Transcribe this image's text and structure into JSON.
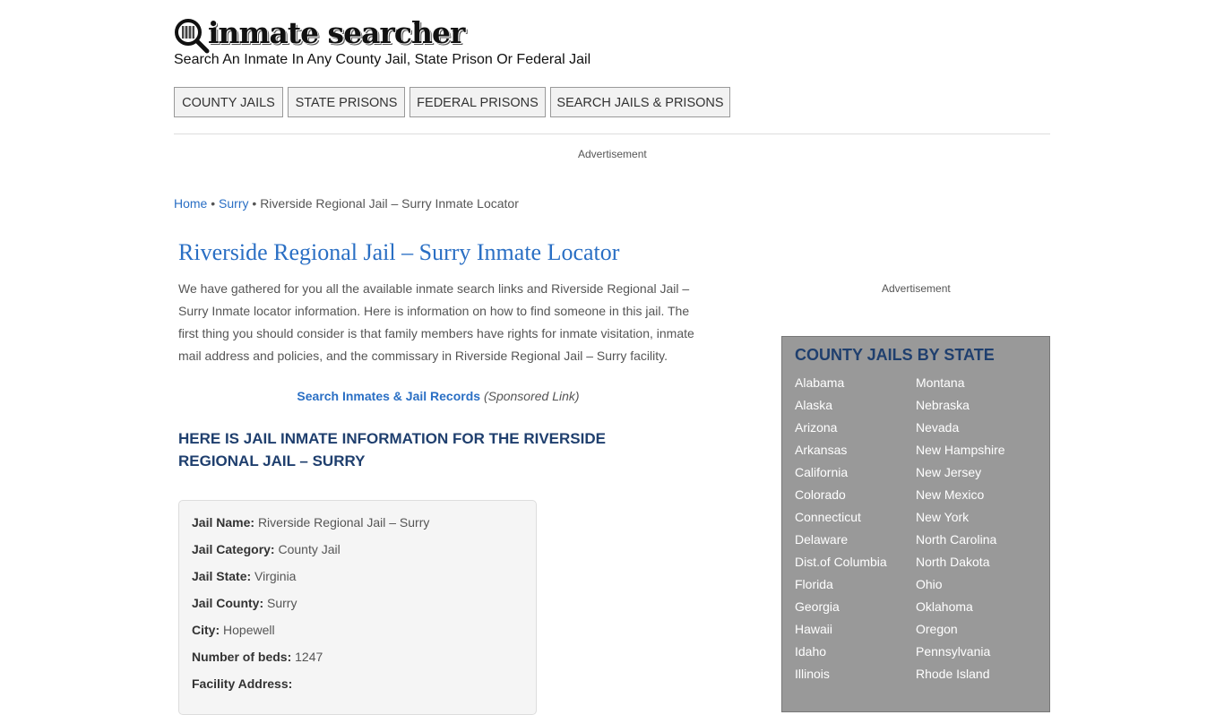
{
  "header": {
    "logo_text": "inmate searcher",
    "tagline": "Search An Inmate In Any County Jail, State Prison Or Federal Jail"
  },
  "nav": {
    "county": "COUNTY JAILS",
    "state": "STATE PRISONS",
    "federal": "FEDERAL PRISONS",
    "search": "SEARCH JAILS & PRISONS"
  },
  "ads": {
    "top": "Advertisement",
    "side": "Advertisement"
  },
  "breadcrumb": {
    "home": "Home",
    "sep": "•",
    "county": "Surry",
    "current": "Riverside Regional Jail – Surry Inmate Locator"
  },
  "main": {
    "title": "Riverside Regional Jail – Surry Inmate Locator",
    "intro": "We have gathered for you all the available inmate search links and Riverside Regional Jail – Surry Inmate locator information. Here is information on how to find someone in this jail. The first thing you should consider is that family members have rights for inmate visitation, inmate mail address and policies, and the commissary in Riverside Regional Jail – Surry facility.",
    "sponsored_link": "Search Inmates & Jail Records",
    "sponsored_note": "(Sponsored Link)",
    "info_heading": "Here is Jail Inmate Information for the Riverside Regional Jail – Surry"
  },
  "info": {
    "name_label": "Jail Name:",
    "name": "Riverside Regional Jail – Surry",
    "category_label": "Jail Category:",
    "category": "County Jail",
    "state_label": "Jail State:",
    "state": "Virginia",
    "county_label": "Jail County:",
    "county": "Surry",
    "city_label": "City:",
    "city": "Hopewell",
    "beds_label": "Number of beds:",
    "beds": "1247",
    "address_label": "Facility Address:"
  },
  "sidebar": {
    "title": "County Jails By State",
    "col1": [
      "Alabama",
      "Alaska",
      "Arizona",
      "Arkansas",
      "California",
      "Colorado",
      "Connecticut",
      "Delaware",
      "Dist.of Columbia",
      "Florida",
      "Georgia",
      "Hawaii",
      "Idaho",
      "Illinois"
    ],
    "col2": [
      "Montana",
      "Nebraska",
      "Nevada",
      "New Hampshire",
      "New Jersey",
      "New Mexico",
      "New York",
      "North Carolina",
      "North Dakota",
      "Ohio",
      "Oklahoma",
      "Oregon",
      "Pennsylvania",
      "Rhode Island"
    ]
  }
}
